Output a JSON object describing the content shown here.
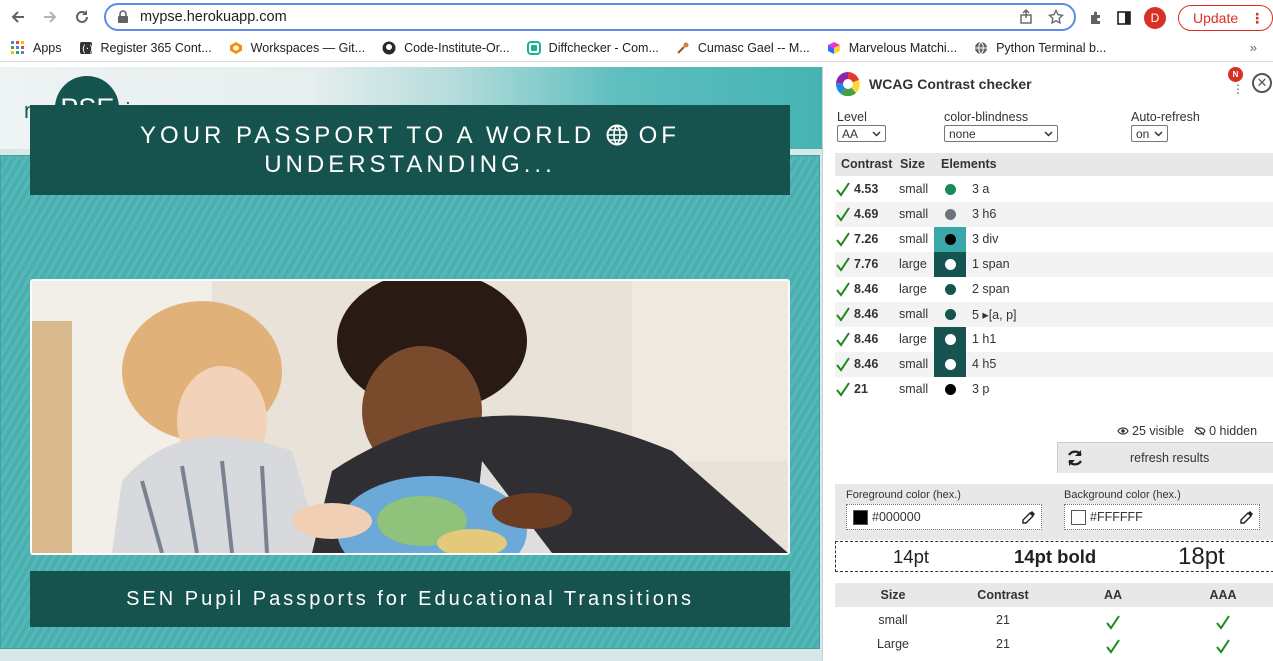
{
  "browser": {
    "url": "mypse.herokuapp.com",
    "avatar_letter": "D",
    "update_label": "Update",
    "bookmarks": [
      {
        "label": "Apps",
        "icon": "apps-grid-icon"
      },
      {
        "label": "Register 365 Cont...",
        "icon": "office-icon"
      },
      {
        "label": "Workspaces — Git...",
        "icon": "gitpod-icon"
      },
      {
        "label": "Code-Institute-Or...",
        "icon": "github-icon"
      },
      {
        "label": "Diffchecker - Com...",
        "icon": "diffchecker-icon"
      },
      {
        "label": "Cumasc Gael -- M...",
        "icon": "guitar-icon"
      },
      {
        "label": "Marvelous Matchi...",
        "icon": "cube-icon"
      },
      {
        "label": "Python Terminal b...",
        "icon": "globe-icon"
      }
    ],
    "more_bookmarks": "»"
  },
  "site": {
    "logo": {
      "prefix": "my",
      "center": "PSE",
      "suffix": ".ie"
    },
    "banner_title_part1": "YOUR PASSPORT TO A WORLD",
    "banner_title_part2": "OF UNDERSTANDING...",
    "footer_title": "SEN Pupil Passports for Educational Transitions",
    "colors": {
      "teal_dark": "#17534e",
      "teal": "#4db5b5"
    }
  },
  "panel": {
    "title": "WCAG Contrast checker",
    "notification_badge": "N",
    "controls": {
      "level_label": "Level",
      "level_value": "AA",
      "blindness_label": "color-blindness",
      "blindness_value": "none",
      "refresh_label": "Auto-refresh",
      "refresh_value": "on"
    },
    "table_headers": {
      "contrast": "Contrast",
      "size": "Size",
      "elements": "Elements"
    },
    "rows": [
      {
        "contrast": "4.53",
        "size": "small",
        "elements": "3 a",
        "dot": "#1a8a5a",
        "bg": ""
      },
      {
        "contrast": "4.69",
        "size": "small",
        "elements": "3 h6",
        "dot": "#6c757d",
        "bg": ""
      },
      {
        "contrast": "7.26",
        "size": "small",
        "elements": "3 div",
        "dot": "#000000",
        "bg": "#3aa8a8"
      },
      {
        "contrast": "7.76",
        "size": "large",
        "elements": "1 span",
        "dot": "#ffffff",
        "bg": "#15544f"
      },
      {
        "contrast": "8.46",
        "size": "large",
        "elements": "2 span",
        "dot": "#15544f",
        "bg": ""
      },
      {
        "contrast": "8.46",
        "size": "small",
        "elements": "5 ▸[a, p]",
        "dot": "#15544f",
        "bg": ""
      },
      {
        "contrast": "8.46",
        "size": "large",
        "elements": "1 h1",
        "dot": "#ffffff",
        "bg": "#15544f"
      },
      {
        "contrast": "8.46",
        "size": "small",
        "elements": "4 h5",
        "dot": "#ffffff",
        "bg": "#15544f"
      },
      {
        "contrast": "21",
        "size": "small",
        "elements": "3 p",
        "dot": "#000000",
        "bg": ""
      }
    ],
    "visible": "25 visible",
    "hidden": "0 hidden",
    "refresh_button": "refresh results",
    "foreground": {
      "label": "Foreground color (hex.)",
      "value": "#000000"
    },
    "background": {
      "label": "Background color (hex.)",
      "value": "#FFFFFF"
    },
    "preview": {
      "normal": "14pt",
      "bold": "14pt bold",
      "large": "18pt"
    },
    "results_headers": {
      "size": "Size",
      "contrast": "Contrast",
      "aa": "AA",
      "aaa": "AAA"
    },
    "results": [
      {
        "size": "small",
        "contrast": "21"
      },
      {
        "size": "Large",
        "contrast": "21"
      }
    ],
    "check_color": "#1b8a1b"
  }
}
